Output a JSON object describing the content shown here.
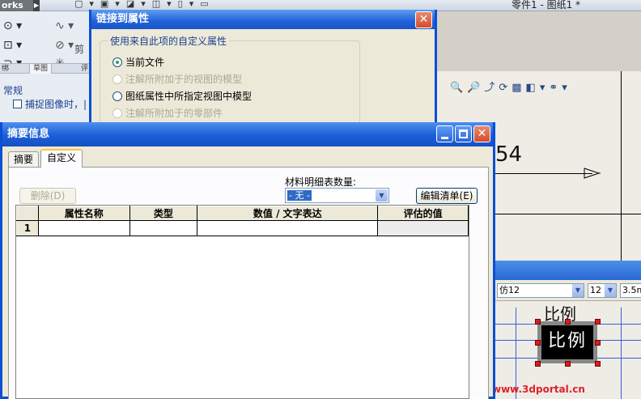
{
  "app": {
    "brand": "orks",
    "document_title": "零件1 - 图纸1 *",
    "left_panel_label": "剪",
    "ribbon_tabs": [
      "绑",
      "草图",
      "评"
    ],
    "property_section_title": "常规",
    "property_checkbox_label": "捕捉图像时，",
    "property_checkbox_tail": "|"
  },
  "link_dialog": {
    "title": "链接到属性",
    "close_glyph": "✕",
    "group_label": "使用来自此项的自定义属性",
    "options": [
      {
        "label": "当前文件",
        "selected": true,
        "enabled": true
      },
      {
        "label": "注解所附加于的视图的模型",
        "selected": false,
        "enabled": false
      },
      {
        "label": "图纸属性中所指定视图中模型",
        "selected": false,
        "enabled": true
      },
      {
        "label": "注解所附加于的零部件",
        "selected": false,
        "enabled": false
      }
    ]
  },
  "summary_dialog": {
    "title": "摘要信息",
    "tabs": [
      "摘要",
      "自定义"
    ],
    "active_tab": "自定义",
    "delete_button": "删除(D)",
    "bom_label": "材料明细表数量:",
    "bom_value": "- 无 -",
    "edit_list_button": "编辑清单(E)",
    "columns": [
      "属性名称",
      "类型",
      "数值 / 文字表达",
      "评估的值"
    ],
    "rows": [
      {
        "num": "1",
        "name": "",
        "type": "",
        "value": "",
        "evaluated": ""
      }
    ]
  },
  "drawing": {
    "dimension_text": "54",
    "font_name": "仿12",
    "font_size": "12",
    "height_value": "3.5m",
    "scale_label_top": "比例",
    "scale_label_box": "比例"
  },
  "watermark": "三维网www.3dportal.cn",
  "colors": {
    "titlebar": "#1a5ed8",
    "dialog_bg": "#ece9d8",
    "scale_box": "#000000",
    "handle": "#d42020",
    "watermark": "#e0202c"
  }
}
